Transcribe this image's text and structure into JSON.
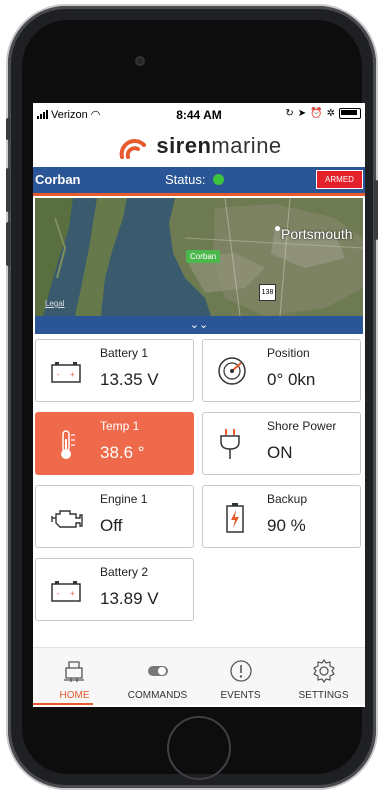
{
  "status_bar": {
    "carrier": "Verizon",
    "time": "8:44 AM"
  },
  "brand": {
    "name_bold": "siren",
    "name_light": "marine"
  },
  "header": {
    "vessel": "Corban",
    "status_label": "Status:",
    "status_color": "#3cc43c",
    "armed_label": "ARMED"
  },
  "map": {
    "place_label": "Portsmouth",
    "pin_label": "Corban",
    "route_number": "138",
    "legal_label": "Legal",
    "toggle_icon": "double-chevron-down-icon"
  },
  "tiles": [
    {
      "title": "Battery 1",
      "value": "13.35 V",
      "icon": "battery-icon"
    },
    {
      "title": "Position",
      "value": "0° 0kn",
      "icon": "gauge-icon"
    },
    {
      "title": "Temp 1",
      "value": "38.6 °",
      "icon": "thermometer-icon",
      "alert": true
    },
    {
      "title": "Shore Power",
      "value": "ON",
      "icon": "plug-icon"
    },
    {
      "title": "Engine 1",
      "value": "Off",
      "icon": "engine-icon"
    },
    {
      "title": "Backup",
      "value": "90 %",
      "icon": "backup-battery-icon"
    },
    {
      "title": "Battery 2",
      "value": "13.89 V",
      "icon": "battery-icon"
    }
  ],
  "tabs": [
    {
      "label": "HOME",
      "icon": "boat-home-icon",
      "active": true
    },
    {
      "label": "COMMANDS",
      "icon": "toggle-icon"
    },
    {
      "label": "EVENTS",
      "icon": "alert-circle-icon"
    },
    {
      "label": "SETTINGS",
      "icon": "gear-icon"
    }
  ],
  "colors": {
    "accent": "#e65a2c",
    "header_blue": "#2a5596",
    "alert_tile": "#ef6a4a",
    "armed": "#e4202a"
  }
}
